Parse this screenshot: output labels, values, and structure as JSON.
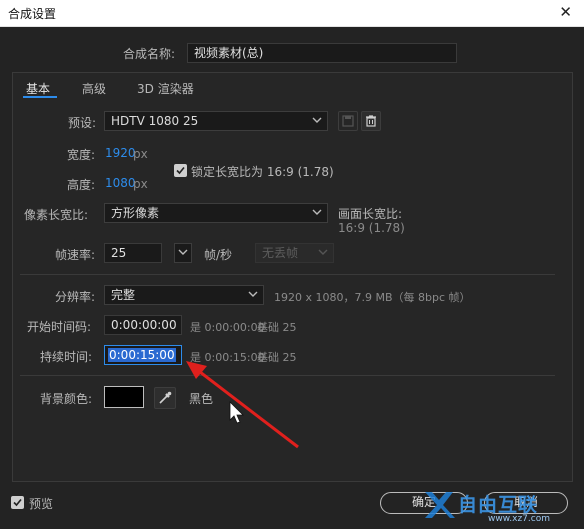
{
  "window": {
    "title": "合成设置",
    "close": "✕"
  },
  "comp_name": {
    "label": "合成名称:",
    "value": "视频素材(总)"
  },
  "tabs": [
    "基本",
    "高级",
    "3D 渲染器"
  ],
  "preset": {
    "label": "预设:",
    "value": "HDTV 1080 25"
  },
  "width": {
    "label": "宽度:",
    "value": "1920",
    "unit": "px"
  },
  "height": {
    "label": "高度:",
    "value": "1080",
    "unit": "px"
  },
  "lock_aspect": {
    "label": "锁定长宽比为 16:9 (1.78)",
    "checked": true
  },
  "pixel_aspect": {
    "label": "像素长宽比:",
    "value": "方形像素"
  },
  "frame_aspect": {
    "label": "画面长宽比:",
    "value": "16:9 (1.78)"
  },
  "frame_rate": {
    "label": "帧速率:",
    "value": "25",
    "unit": "帧/秒",
    "drop_frame": "无丢帧"
  },
  "resolution": {
    "label": "分辨率:",
    "value": "完整",
    "info": "1920 x 1080，7.9 MB（每 8bpc 帧）"
  },
  "start_timecode": {
    "label": "开始时间码:",
    "value": "0:00:00:00",
    "info": "是 0:00:00:00",
    "base": "基础 25"
  },
  "duration": {
    "label": "持续时间:",
    "value": "0:00:15:00",
    "info": "是 0:00:15:00",
    "base": "基础 25"
  },
  "background": {
    "label": "背景颜色:",
    "color_name": "黑色",
    "swatch": "#000000"
  },
  "preview": {
    "label": "预览",
    "checked": true
  },
  "buttons": {
    "ok": "确定",
    "cancel": "取消"
  },
  "watermark": {
    "text": "自由互联",
    "url": "www.xz7.com"
  },
  "colors": {
    "accent": "#2d8ceb",
    "annotation": "#e0201d"
  }
}
